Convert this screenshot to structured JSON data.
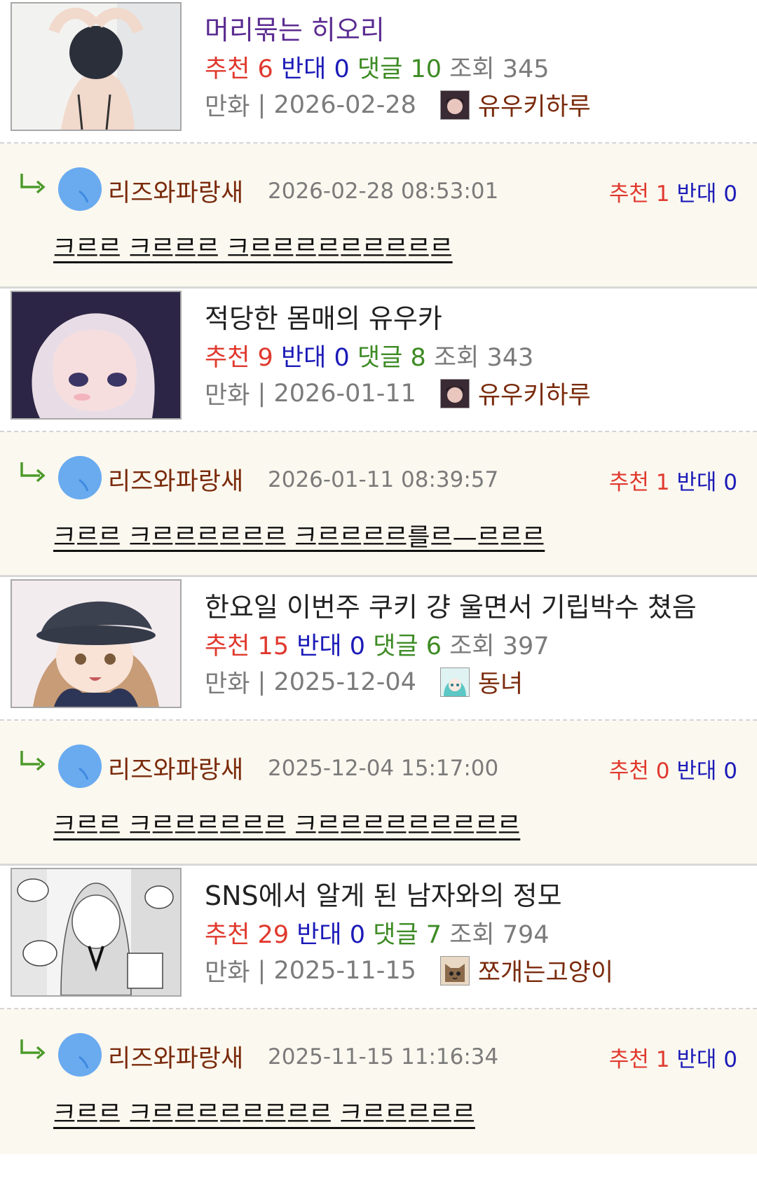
{
  "labels": {
    "up": "추천",
    "down": "반대",
    "comments": "댓글",
    "views": "조회",
    "sep": " | "
  },
  "posts": [
    {
      "title": "머리묶는 히오리",
      "visited": true,
      "up": "6",
      "down": "0",
      "comments": "10",
      "views": "345",
      "category": "만화",
      "date": "2026-02-28",
      "author": "유우키하루",
      "comment": {
        "author": "리즈와파랑새",
        "datetime": "2026-02-28 08:53:01",
        "up": "1",
        "down": "0",
        "text": "크르르 크르르르 크르르르르르르르르르"
      }
    },
    {
      "title": "적당한 몸매의 유우카",
      "visited": false,
      "up": "9",
      "down": "0",
      "comments": "8",
      "views": "343",
      "category": "만화",
      "date": "2026-01-11",
      "author": "유우키하루",
      "comment": {
        "author": "리즈와파랑새",
        "datetime": "2026-01-11 08:39:57",
        "up": "1",
        "down": "0",
        "text": "크르르 크르르르르르르 크르르르르를르—르르르"
      }
    },
    {
      "title": "한요일 이번주 쿠키 걍 울면서 기립박수 쳤음",
      "visited": false,
      "up": "15",
      "down": "0",
      "comments": "6",
      "views": "397",
      "category": "만화",
      "date": "2025-12-04",
      "author": "동녀",
      "comment": {
        "author": "리즈와파랑새",
        "datetime": "2025-12-04 15:17:00",
        "up": "0",
        "down": "0",
        "text": "크르르 크르르르르르르 크르르르르르르르르르"
      }
    },
    {
      "title": "SNS에서 알게 된 남자와의 정모",
      "visited": false,
      "up": "29",
      "down": "0",
      "comments": "7",
      "views": "794",
      "category": "만화",
      "date": "2025-11-15",
      "author": "쪼개는고양이",
      "comment": {
        "author": "리즈와파랑새",
        "datetime": "2025-11-15 11:16:34",
        "up": "1",
        "down": "0",
        "text": "크르르 크르르르르르르르르 크르르르르르"
      }
    }
  ]
}
